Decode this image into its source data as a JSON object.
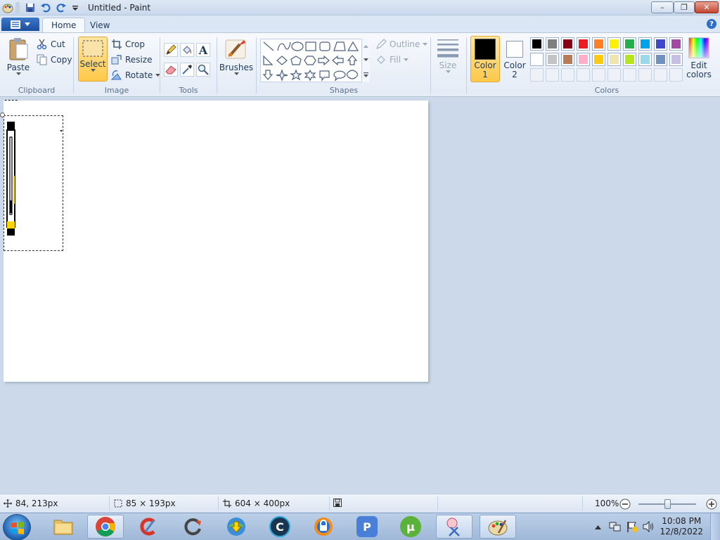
{
  "window": {
    "title": "Untitled - Paint",
    "controls": {
      "minimize": "–",
      "maximize": "❐",
      "close": "✕"
    }
  },
  "tabs": [
    {
      "label": "Home"
    },
    {
      "label": "View"
    }
  ],
  "help": "?",
  "ribbon": {
    "clipboard": {
      "label": "Clipboard",
      "paste": "Paste",
      "cut": "Cut",
      "copy": "Copy"
    },
    "image": {
      "label": "Image",
      "select": "Select",
      "crop": "Crop",
      "resize": "Resize",
      "rotate": "Rotate"
    },
    "tools": {
      "label": "Tools",
      "text_glyph": "A"
    },
    "brushes": {
      "label": "Brushes"
    },
    "shapes": {
      "label": "Shapes",
      "outline": "Outline",
      "fill": "Fill"
    },
    "size": {
      "label": "Size"
    },
    "color1": {
      "line1": "Color",
      "line2": "1",
      "value": "#000000"
    },
    "color2": {
      "line1": "Color",
      "line2": "2",
      "value": "#ffffff"
    },
    "colors": {
      "label": "Colors",
      "row1": [
        "#000000",
        "#7f7f7f",
        "#880015",
        "#ed1c24",
        "#ff7f27",
        "#fff200",
        "#22b14c",
        "#00a2e8",
        "#3f48cc",
        "#a349a4"
      ],
      "row2": [
        "#ffffff",
        "#c3c3c3",
        "#b97a57",
        "#ffaec9",
        "#ffc90e",
        "#efe4b0",
        "#b5e61d",
        "#99d9ea",
        "#7092be",
        "#c8bfe7"
      ]
    },
    "edit_colors": {
      "line1": "Edit",
      "line2": "colors"
    }
  },
  "status": {
    "cursor": "84, 213px",
    "selection": "85 × 193px",
    "canvas_size": "604 × 400px",
    "zoom": "100%",
    "zoom_level": 1.0
  },
  "taskbar": {
    "apps": [
      "Windows Explorer",
      "Google Chrome",
      "CCleaner",
      "Reload",
      "Internet Download Manager",
      "CCleaner Browser",
      "Avast Secure Browser",
      "PicPick",
      "uTorrent",
      "Snipping Tool",
      "Paint"
    ],
    "time": "10:08 PM",
    "date": "12/8/2022"
  }
}
